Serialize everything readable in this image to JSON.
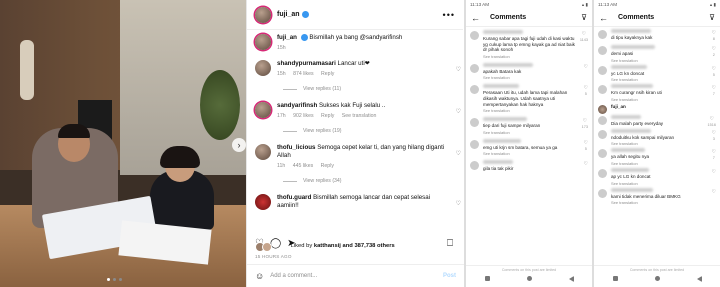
{
  "post": {
    "username": "fuji_an",
    "more_icon": "more-icon",
    "comments": [
      {
        "user": "fuji_an",
        "text": "Bismillah ya bang @sandyarifinsh",
        "time": "15h",
        "likes": "",
        "reply": "",
        "translation": "",
        "view_replies": ""
      },
      {
        "user": "shandypurnamasari",
        "text": "Lancar uti❤",
        "time": "15h",
        "likes": "874 likes",
        "reply": "Reply",
        "translation": "",
        "view_replies": "View replies (11)"
      },
      {
        "user": "sandyarifinsh",
        "text": "Sukses kak Fuji selalu ..",
        "time": "17h",
        "likes": "902 likes",
        "reply": "Reply",
        "translation": "See translation",
        "view_replies": "View replies (19)"
      },
      {
        "user": "thofu_licious",
        "text": "Semoga cepet kelar ti, dan yang hilang diganti Allah",
        "time": "11h",
        "likes": "445 likes",
        "reply": "Reply",
        "translation": "",
        "view_replies": "View replies (34)"
      },
      {
        "user": "thofu.guard",
        "text": "Bismillah semoga lancar dan cepat selesai aamiin!!",
        "time": "",
        "likes": "",
        "reply": "",
        "translation": "",
        "view_replies": ""
      }
    ],
    "likes_text": "Liked by",
    "likes_user": "katthansij",
    "likes_rest": "and 387,738 others",
    "posted": "15 HOURS AGO",
    "add_comment_placeholder": "Add a comment...",
    "post_button": "Post",
    "carousel": {
      "count": 3,
      "active": 1
    }
  },
  "phone1": {
    "status_left": "11:13 AM",
    "status_right": "▴ ▮",
    "title": "Comments",
    "comments": [
      {
        "text": "Kurang sabar apa tagi fuji udah di kasi waktu yg cukup lama tp emng kayak ga ad niat baik dr pihak sonoh",
        "link": "See translation",
        "likes": "1143"
      },
      {
        "text": "apakah Batara kak",
        "link": "See translation",
        "likes": ""
      },
      {
        "text": "Perasaan Uti itu, udah lama tapi malahan dikasih waktunya. Udah saatnya uti mempertanyakan hak haknya",
        "link": "See translation",
        "likes": "5"
      },
      {
        "text": "tiep dari fuji sampe milyaran",
        "link": "See translation",
        "likes": "173"
      },
      {
        "text": "emg uti krjn sm batara, semua ya ga",
        "link": "See translation",
        "likes": "5"
      },
      {
        "text": "gila tia tak pikir",
        "link": "",
        "likes": ""
      }
    ],
    "hint": "Comments on this post are limited"
  },
  "phone2": {
    "status_left": "11:13 AM",
    "status_right": "▴ ▮",
    "title": "Comments",
    "comments": [
      {
        "text": "di tipu kayaknya kak",
        "link": "",
        "likes": "8"
      },
      {
        "text": "demi apasi",
        "link": "See translation",
        "likes": "2"
      },
      {
        "text": "yc LG kn doncat",
        "link": "See translation",
        "likes": "5"
      },
      {
        "text": "Km curangr nsih kiran uti",
        "link": "See translation",
        "likes": "7"
      },
      {
        "text": "fuji_an",
        "link": "",
        "likes": ""
      },
      {
        "text": "Dia malah party everyday",
        "link": "",
        "likes": "1516"
      },
      {
        "text": "ndoduitku kok sampai milyaran",
        "link": "See translation",
        "likes": "3"
      },
      {
        "text": "ya allah segitu nya",
        "link": "See translation",
        "likes": "7"
      },
      {
        "text": "ap yc LG kn doncat",
        "link": "See translation",
        "likes": ""
      },
      {
        "text": "kami tidak menerima diluar BMKG",
        "link": "See translation",
        "likes": ""
      }
    ],
    "hint": "Comments on this post are limited"
  }
}
